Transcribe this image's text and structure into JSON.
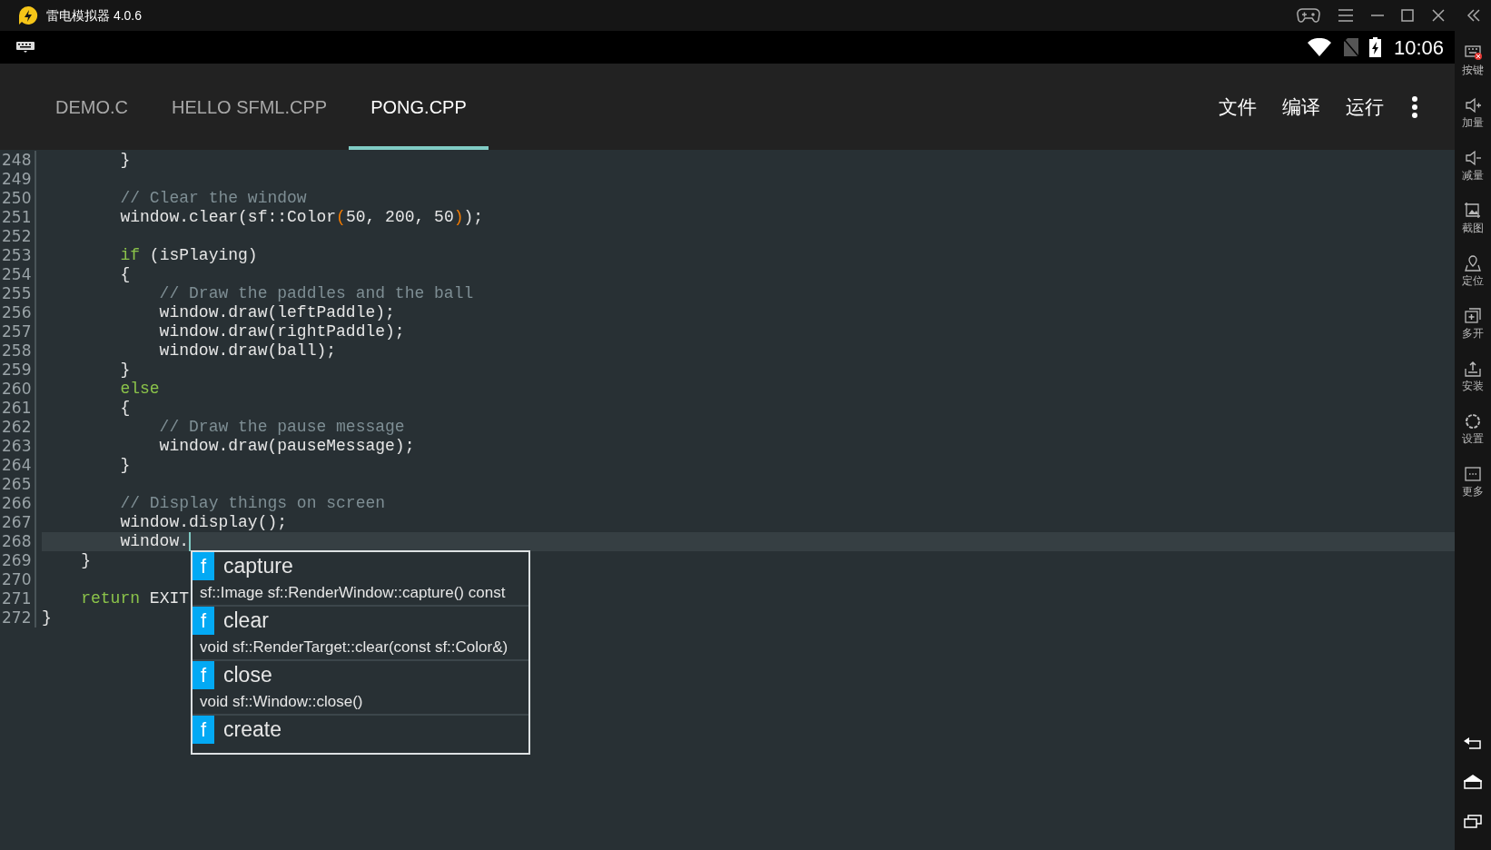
{
  "window": {
    "title": "雷电模拟器 4.0.6"
  },
  "status_bar": {
    "time": "10:06"
  },
  "tabs": [
    {
      "label": "DEMO.C",
      "selected": false
    },
    {
      "label": "HELLO SFML.CPP",
      "selected": false
    },
    {
      "label": "PONG.CPP",
      "selected": true
    }
  ],
  "actions": [
    "文件",
    "编译",
    "运行"
  ],
  "editor": {
    "lines": [
      {
        "number": "248",
        "current": false,
        "tokens": [
          {
            "kind": "plain",
            "text": "        }"
          }
        ]
      },
      {
        "number": "249",
        "current": false
      },
      {
        "number": "250",
        "current": false,
        "tokens": [
          {
            "kind": "comment",
            "text": "        // Clear the window"
          }
        ]
      },
      {
        "number": "251",
        "current": false,
        "tokens": [
          {
            "kind": "plain",
            "text": "        window.clear(sf::Color"
          },
          {
            "kind": "paren",
            "text": "("
          },
          {
            "kind": "plain",
            "text": "50, 200, 50"
          },
          {
            "kind": "paren",
            "text": ")"
          },
          {
            "kind": "plain",
            "text": ");"
          }
        ]
      },
      {
        "number": "252",
        "current": false
      },
      {
        "number": "253",
        "current": false,
        "tokens": [
          {
            "kind": "keyword",
            "text": "        if"
          },
          {
            "kind": "plain",
            "text": " (isPlaying)"
          }
        ]
      },
      {
        "number": "254",
        "current": false,
        "tokens": [
          {
            "kind": "plain",
            "text": "        {"
          }
        ]
      },
      {
        "number": "255",
        "current": false,
        "tokens": [
          {
            "kind": "comment",
            "text": "            // Draw the paddles and the ball"
          }
        ]
      },
      {
        "number": "256",
        "current": false,
        "tokens": [
          {
            "kind": "plain",
            "text": "            window.draw(leftPaddle);"
          }
        ]
      },
      {
        "number": "257",
        "current": false,
        "tokens": [
          {
            "kind": "plain",
            "text": "            window.draw(rightPaddle);"
          }
        ]
      },
      {
        "number": "258",
        "current": false,
        "tokens": [
          {
            "kind": "plain",
            "text": "            window.draw(ball);"
          }
        ]
      },
      {
        "number": "259",
        "current": false,
        "tokens": [
          {
            "kind": "plain",
            "text": "        }"
          }
        ]
      },
      {
        "number": "260",
        "current": false,
        "tokens": [
          {
            "kind": "keyword",
            "text": "        else"
          }
        ]
      },
      {
        "number": "261",
        "current": false,
        "tokens": [
          {
            "kind": "plain",
            "text": "        {"
          }
        ]
      },
      {
        "number": "262",
        "current": false,
        "tokens": [
          {
            "kind": "comment",
            "text": "            // Draw the pause message"
          }
        ]
      },
      {
        "number": "263",
        "current": false,
        "tokens": [
          {
            "kind": "plain",
            "text": "            window.draw(pauseMessage);"
          }
        ]
      },
      {
        "number": "264",
        "current": false,
        "tokens": [
          {
            "kind": "plain",
            "text": "        }"
          }
        ]
      },
      {
        "number": "265",
        "current": false
      },
      {
        "number": "266",
        "current": false,
        "tokens": [
          {
            "kind": "comment",
            "text": "        // Display things on screen"
          }
        ]
      },
      {
        "number": "267",
        "current": false,
        "tokens": [
          {
            "kind": "plain",
            "text": "        window.display();"
          }
        ]
      },
      {
        "number": "268",
        "current": true,
        "tokens": [
          {
            "kind": "plain",
            "text": "        window."
          }
        ]
      },
      {
        "number": "269",
        "current": false,
        "tokens": [
          {
            "kind": "plain",
            "text": "    }"
          }
        ]
      },
      {
        "number": "270",
        "current": false
      },
      {
        "number": "271",
        "current": false,
        "tokens": [
          {
            "kind": "keyword",
            "text": "    return"
          },
          {
            "kind": "plain",
            "text": " EXIT"
          }
        ]
      },
      {
        "number": "272",
        "current": false,
        "tokens": [
          {
            "kind": "plain",
            "text": "}"
          }
        ]
      }
    ]
  },
  "autocomplete": {
    "items": [
      {
        "badge": "f",
        "name": "capture",
        "signature": "sf::Image sf::RenderWindow::capture() const"
      },
      {
        "badge": "f",
        "name": "clear",
        "signature": "void sf::RenderTarget::clear(const sf::Color&)"
      },
      {
        "badge": "f",
        "name": "close",
        "signature": "void sf::Window::close()"
      },
      {
        "badge": "f",
        "name": "create"
      }
    ]
  },
  "sidebar": {
    "items": [
      {
        "kind": "keys",
        "label": "按键"
      },
      {
        "kind": "volume-up",
        "label": "加量"
      },
      {
        "kind": "volume-down",
        "label": "减量"
      },
      {
        "kind": "screenshot",
        "label": "截图"
      },
      {
        "kind": "location",
        "label": "定位"
      },
      {
        "kind": "multi",
        "label": "多开"
      },
      {
        "kind": "install",
        "label": "安装"
      },
      {
        "kind": "settings",
        "label": "设置"
      },
      {
        "kind": "more",
        "label": "更多"
      }
    ]
  }
}
